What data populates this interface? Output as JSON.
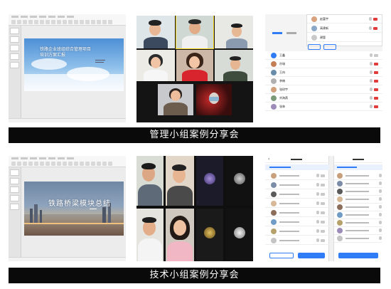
{
  "banners": {
    "top": "管理小组案例分享会",
    "bottom": "技术小组案例分享会"
  },
  "top_slide": {
    "title_line1": "铁路企业班组综合管理项目",
    "title_line2": "培训方案汇报"
  },
  "bottom_slide": {
    "title": "铁路桥梁模块总结"
  },
  "top_members": [
    "赵富宇",
    "高建新",
    "谢管",
    "王鑫",
    "孙瑞",
    "王冉",
    "李楠",
    "张琼宇",
    "刘海燕",
    "张林"
  ],
  "colors": {
    "banner_bg": "#0a0a0a",
    "accent_blue": "#2f7cf6",
    "camera_off_red": "#e23b3b",
    "active_speaker_yellow": "#f2d21b"
  }
}
